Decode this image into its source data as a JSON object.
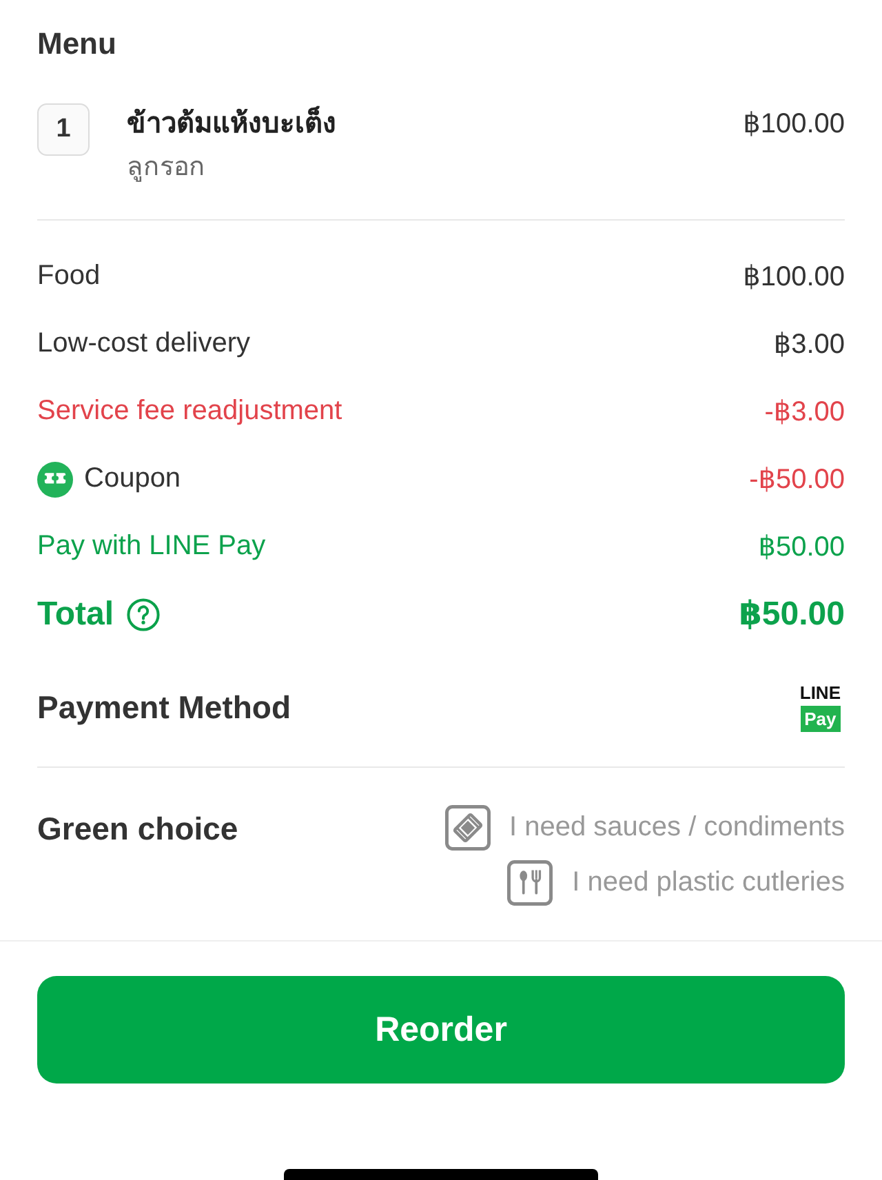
{
  "menu": {
    "title": "Menu",
    "items": [
      {
        "quantity": "1",
        "name": "ข้าวต้มแห้งบะเต็ง",
        "option": "ลูกรอก",
        "price": "฿100.00"
      }
    ]
  },
  "summary": [
    {
      "kind": "plain",
      "label": "Food",
      "amount": "฿100.00"
    },
    {
      "kind": "plain",
      "label": "Low-cost delivery",
      "amount": "฿3.00"
    },
    {
      "kind": "discount",
      "label": "Service fee readjustment",
      "amount": "-฿3.00"
    },
    {
      "kind": "coupon",
      "label": "Coupon",
      "amount": "-฿50.00"
    },
    {
      "kind": "payment",
      "label": "Pay with LINE Pay",
      "amount": "฿50.00"
    },
    {
      "kind": "total",
      "label": "Total",
      "amount": "฿50.00"
    }
  ],
  "payment_method": {
    "title": "Payment Method",
    "logo_top": "LINE",
    "logo_badge": "Pay"
  },
  "green_choice": {
    "title": "Green choice",
    "options": [
      {
        "kind": "sauces",
        "label": "I need sauces / condiments",
        "checked": false
      },
      {
        "kind": "cutlery",
        "label": "I need plastic cutleries",
        "checked": false
      }
    ]
  },
  "reorder_button": "Reorder"
}
